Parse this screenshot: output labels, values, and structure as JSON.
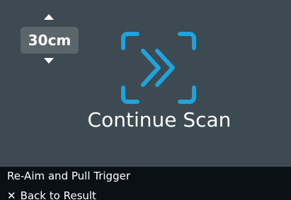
{
  "distance": {
    "value": "30cm",
    "up_icon": "triangle-up-icon",
    "down_icon": "triangle-down-icon"
  },
  "scan": {
    "label": "Continue Scan",
    "icon": "scan-forward-icon",
    "accent": "#1fa3dc"
  },
  "footer": {
    "hint": "Re-Aim and Pull Trigger",
    "back_icon": "close-x-icon",
    "back_glyph": "✕",
    "back_label": "Back to Result"
  },
  "colors": {
    "background": "#3d4a51",
    "distance_box": "#5b666c",
    "footer_bar": "#0b1016",
    "text": "#ffffff"
  }
}
